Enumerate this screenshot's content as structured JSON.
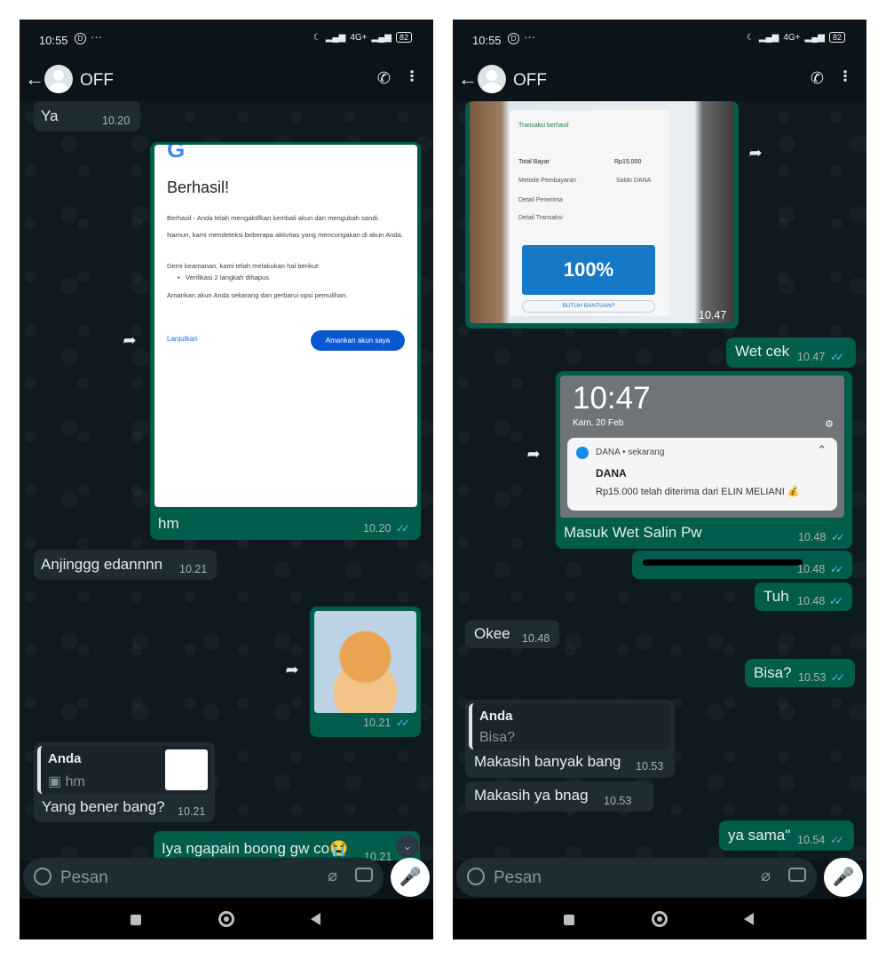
{
  "left": {
    "status": {
      "time": "10:55",
      "dnd": "D",
      "dots": "···",
      "network": "4G+",
      "battery": "82"
    },
    "header": {
      "back": "←",
      "name": "OFF"
    },
    "messages": {
      "ya": {
        "text": "Ya",
        "time": "10.20"
      },
      "google_card": {
        "title": "Berhasil!",
        "p1": "Berhasil - Anda telah mengaktifkan kembali akun dan mengubah sandi.",
        "p2": "Namun, kami mendeteksi beberapa aktivitas yang mencurigakan di akun Anda.",
        "p3": "Demi keamanan, kami telah melakukan hal berikut:",
        "bullet": "Verifikasi 2 langkah dihapus",
        "p4": "Amankan akun Anda sekarang dan perbarui opsi pemulihan.",
        "link": "Lanjutkan",
        "button": "Amankan akun saya"
      },
      "hm": {
        "text": "hm",
        "time": "10.20"
      },
      "anjing": {
        "text": "Anjinggg edannnn",
        "time": "10.21"
      },
      "kitten": {
        "time": "10.21"
      },
      "reply": {
        "quote_name": "Anda",
        "quote_text": "hm",
        "text": "Yang bener bang?",
        "time": "10.21"
      },
      "iya": {
        "text": "Iya ngapain boong gw co😭",
        "time": "10.21"
      }
    },
    "input": {
      "placeholder": "Pesan"
    }
  },
  "right": {
    "status": {
      "time": "10:55",
      "dnd": "D",
      "dots": "···",
      "network": "4G+",
      "battery": "82"
    },
    "header": {
      "back": "←",
      "name": "OFF"
    },
    "messages": {
      "photo": {
        "time": "10.47",
        "total_label": "Total Bayar",
        "total_value": "Rp15.000",
        "method_label": "Metode Pembayaran",
        "method_value": "Saldo DANA",
        "row3": "Detail Penerima",
        "row4": "Detail Transaksi",
        "success": "Transaksi berhasil",
        "promo": "100%",
        "help": "BUTUH BANTUAN?"
      },
      "wetcek": {
        "text": "Wet cek",
        "time": "10.47"
      },
      "notif": {
        "clock": "10:47",
        "date": "Kam, 20 Feb",
        "app": "DANA • sekarang",
        "title": "DANA",
        "body": "Rp15.000 telah diterima dari ELIN MELIANI 💰"
      },
      "masuk": {
        "text": "Masuk Wet Salin Pw",
        "time": "10.48"
      },
      "redacted": {
        "time": "10.48"
      },
      "tuh": {
        "text": "Tuh",
        "time": "10.48"
      },
      "okee": {
        "text": "Okee",
        "time": "10.48"
      },
      "bisa": {
        "text": "Bisa?",
        "time": "10.53"
      },
      "makasih1": {
        "quote_name": "Anda",
        "quote_text": "Bisa?",
        "text": "Makasih banyak bang",
        "time": "10.53"
      },
      "makasih2": {
        "text": "Makasih ya bnag",
        "time": "10.53"
      },
      "yasama": {
        "text": "ya sama\"",
        "time": "10.54"
      }
    },
    "input": {
      "placeholder": "Pesan"
    }
  },
  "colors": {
    "incoming": "#1f2c34",
    "outgoing": "#005c4b",
    "read_tick": "#53bdeb",
    "background": "#0b141a"
  }
}
